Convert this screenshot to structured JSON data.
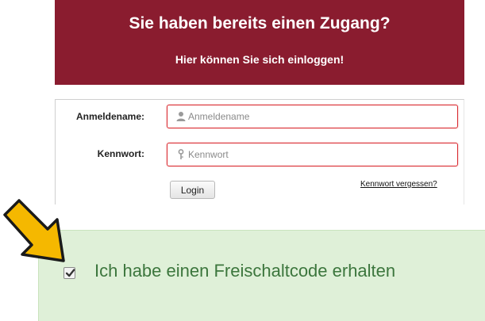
{
  "banner": {
    "title": "Sie haben bereits einen Zugang?",
    "subtitle": "Hier können Sie sich einloggen!"
  },
  "login_form": {
    "username_label": "Anmeldename:",
    "username_placeholder": "Anmeldename",
    "username_value": "",
    "username_icon": "user-icon",
    "password_label": "Kennwort:",
    "password_placeholder": "Kennwort",
    "password_value": "",
    "password_icon": "key-icon",
    "login_button": "Login",
    "forgot_link": "Kennwort vergessen?"
  },
  "activation": {
    "checkbox_label": "Ich habe einen Freischaltcode erhalten",
    "checked": true
  },
  "colors": {
    "banner_bg": "#8a1c2f",
    "field_border": "#d9292f",
    "activation_bg": "#dff0d8",
    "activation_text": "#3c763d",
    "arrow_fill": "#f5b800"
  }
}
